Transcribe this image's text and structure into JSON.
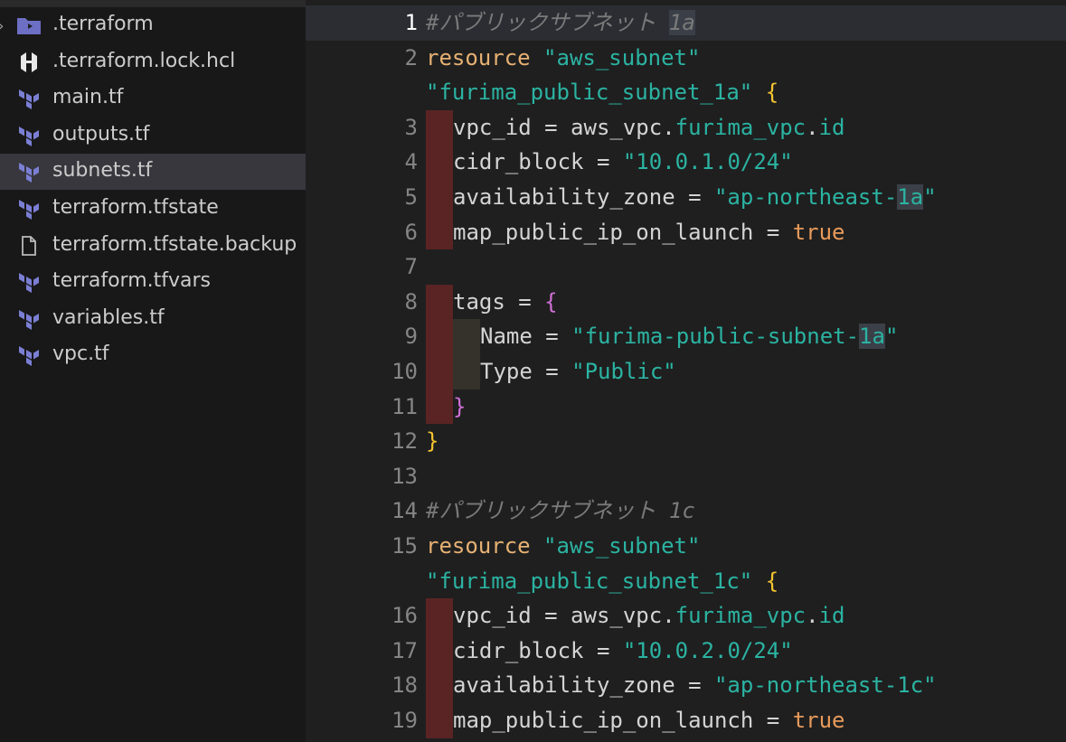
{
  "explorer": {
    "items": [
      {
        "label": ".terraform",
        "icon": "folder-icon",
        "expandable": true
      },
      {
        "label": ".terraform.lock.hcl",
        "icon": "hcl-icon"
      },
      {
        "label": "main.tf",
        "icon": "terraform-icon"
      },
      {
        "label": "outputs.tf",
        "icon": "terraform-icon"
      },
      {
        "label": "subnets.tf",
        "icon": "terraform-icon",
        "selected": true
      },
      {
        "label": "terraform.tfstate",
        "icon": "terraform-icon"
      },
      {
        "label": "terraform.tfstate.backup",
        "icon": "file-icon"
      },
      {
        "label": "terraform.tfvars",
        "icon": "terraform-icon"
      },
      {
        "label": "variables.tf",
        "icon": "terraform-icon"
      },
      {
        "label": "vpc.tf",
        "icon": "terraform-icon"
      }
    ]
  },
  "editor": {
    "lines": [
      {
        "n": "1",
        "active": true,
        "parts": [
          [
            "c-comment",
            "#パブリックサブネット "
          ],
          [
            "c-comment hl",
            "1a"
          ]
        ]
      },
      {
        "n": "2",
        "parts": [
          [
            "c-kw",
            "resource "
          ],
          [
            "c-str",
            "\"aws_subnet\""
          ]
        ]
      },
      {
        "n": "",
        "parts": [
          [
            "c-str",
            "\"furima_public_subnet_1a\" "
          ],
          [
            "c-brace",
            "{"
          ]
        ]
      },
      {
        "n": "3",
        "gutter": "red",
        "indent": 1,
        "parts": [
          [
            "c-attr",
            "vpc_id = aws_vpc."
          ],
          [
            "c-prop",
            "furima_vpc"
          ],
          [
            "c-attr",
            "."
          ],
          [
            "c-prop",
            "id"
          ]
        ]
      },
      {
        "n": "4",
        "gutter": "red",
        "indent": 1,
        "parts": [
          [
            "c-attr",
            "cidr_block = "
          ],
          [
            "c-str",
            "\"10.0.1.0/24\""
          ]
        ]
      },
      {
        "n": "5",
        "gutter": "red",
        "indent": 1,
        "parts": [
          [
            "c-attr",
            "availability_zone = "
          ],
          [
            "c-str",
            "\"ap-northeast-"
          ],
          [
            "c-str hl",
            "1a"
          ],
          [
            "c-str",
            "\""
          ]
        ]
      },
      {
        "n": "6",
        "gutter": "red",
        "indent": 1,
        "parts": [
          [
            "c-attr",
            "map_public_ip_on_launch = "
          ],
          [
            "c-bool",
            "true"
          ]
        ]
      },
      {
        "n": "7",
        "parts": []
      },
      {
        "n": "8",
        "gutter": "red",
        "indent": 1,
        "parts": [
          [
            "c-attr",
            "tags = "
          ],
          [
            "c-brace2",
            "{"
          ]
        ]
      },
      {
        "n": "9",
        "gutter": "olive",
        "indent": 2,
        "parts": [
          [
            "c-attr",
            "Name = "
          ],
          [
            "c-str",
            "\"furima-public-subnet-"
          ],
          [
            "c-str hl",
            "1a"
          ],
          [
            "c-str",
            "\""
          ]
        ]
      },
      {
        "n": "10",
        "gutter": "olive",
        "indent": 2,
        "parts": [
          [
            "c-attr",
            "Type = "
          ],
          [
            "c-str",
            "\"Public\""
          ]
        ]
      },
      {
        "n": "11",
        "gutter": "red",
        "indent": 1,
        "parts": [
          [
            "c-brace2",
            "}"
          ]
        ]
      },
      {
        "n": "12",
        "parts": [
          [
            "c-brace",
            "}"
          ]
        ]
      },
      {
        "n": "13",
        "parts": []
      },
      {
        "n": "14",
        "parts": [
          [
            "c-comment",
            "#パブリックサブネット 1c"
          ]
        ]
      },
      {
        "n": "15",
        "parts": [
          [
            "c-kw",
            "resource "
          ],
          [
            "c-str",
            "\"aws_subnet\""
          ]
        ]
      },
      {
        "n": "",
        "parts": [
          [
            "c-str",
            "\"furima_public_subnet_1c\" "
          ],
          [
            "c-brace",
            "{"
          ]
        ]
      },
      {
        "n": "16",
        "gutter": "red",
        "indent": 1,
        "parts": [
          [
            "c-attr",
            "vpc_id = aws_vpc."
          ],
          [
            "c-prop",
            "furima_vpc"
          ],
          [
            "c-attr",
            "."
          ],
          [
            "c-prop",
            "id"
          ]
        ]
      },
      {
        "n": "17",
        "gutter": "red",
        "indent": 1,
        "parts": [
          [
            "c-attr",
            "cidr_block = "
          ],
          [
            "c-str",
            "\"10.0.2.0/24\""
          ]
        ]
      },
      {
        "n": "18",
        "gutter": "red",
        "indent": 1,
        "parts": [
          [
            "c-attr",
            "availability_zone = "
          ],
          [
            "c-str",
            "\"ap-northeast-1c\""
          ]
        ]
      },
      {
        "n": "19",
        "gutter": "red",
        "indent": 1,
        "parts": [
          [
            "c-attr",
            "map_public_ip_on_launch = "
          ],
          [
            "c-bool",
            "true"
          ]
        ]
      }
    ]
  },
  "colors": {
    "terraform_icon": "#7b7fd4",
    "string": "#2bb3a2",
    "keyword": "#e6b173",
    "gutter_modified": "#5a2424"
  }
}
